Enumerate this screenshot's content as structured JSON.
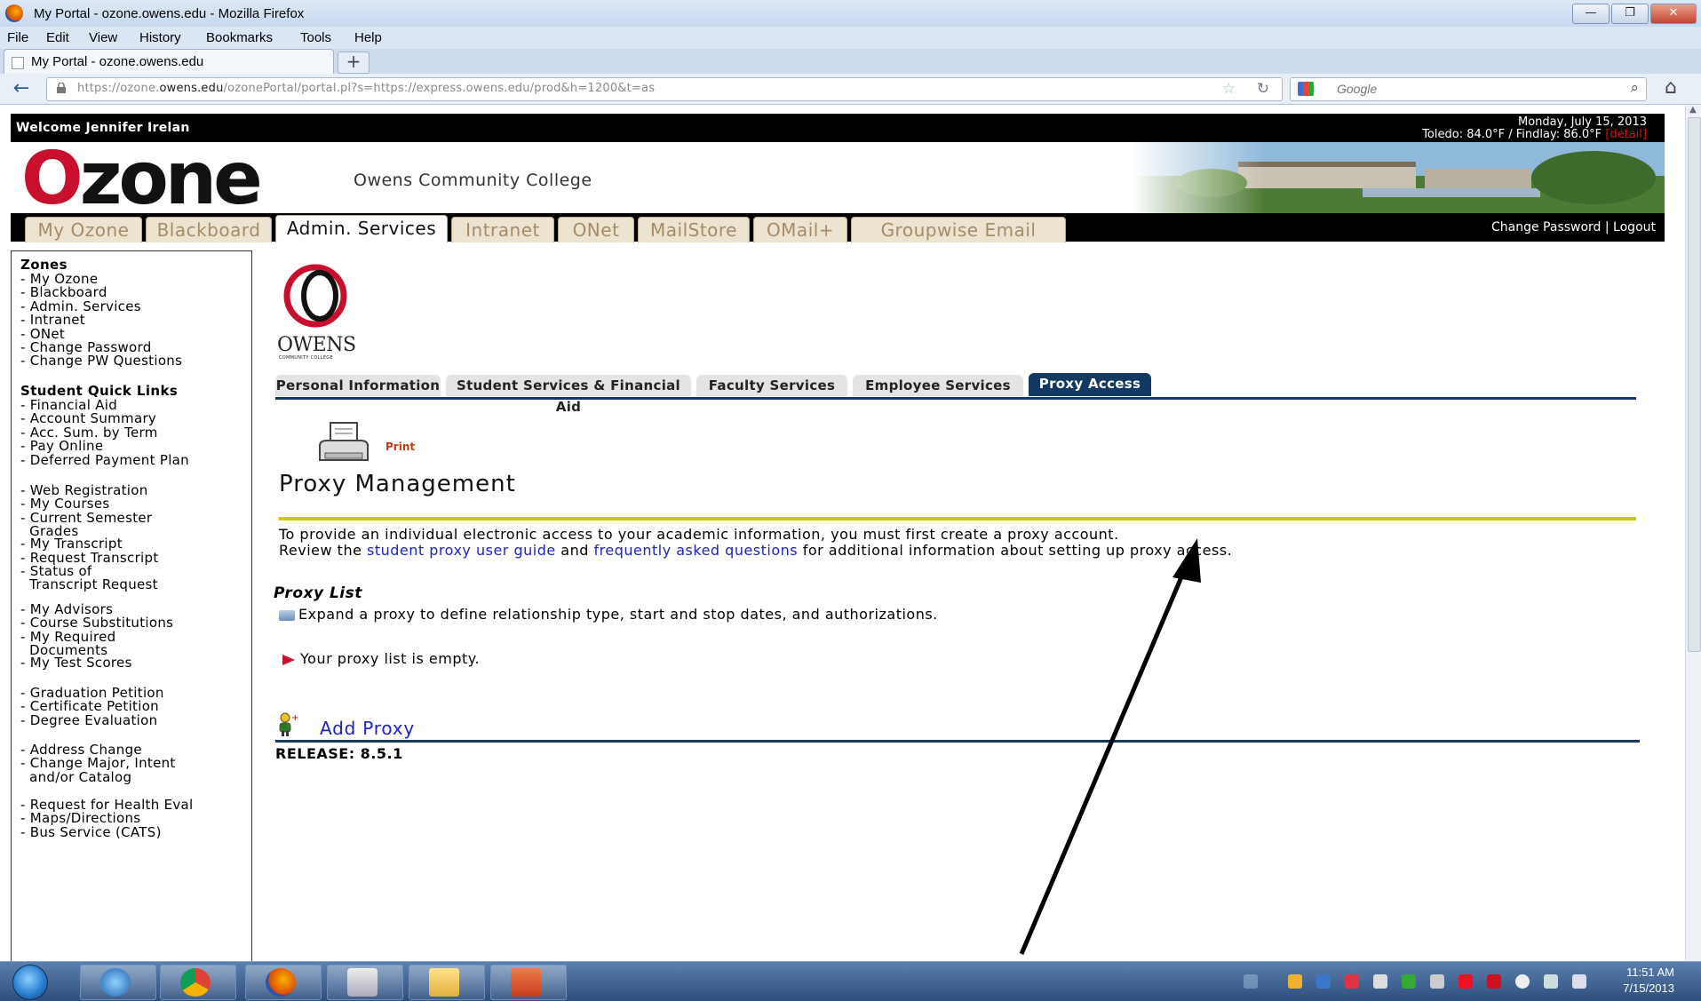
{
  "window": {
    "title": "My Portal - ozone.owens.edu - Mozilla Firefox",
    "controls": [
      "—",
      "❐",
      "✕"
    ]
  },
  "menubar": [
    "File",
    "Edit",
    "View",
    "History",
    "Bookmarks",
    "Tools",
    "Help"
  ],
  "browser_tab": {
    "label": "My Portal - ozone.owens.edu",
    "new_tab_label": "+"
  },
  "navbar": {
    "url_host": "https://ozone.",
    "url_domain": "owens.edu",
    "url_path": "/ozonePortal/portal.pl?s=https://express.owens.edu/prod&h=1200&t=as",
    "search_placeholder": "Google"
  },
  "portal": {
    "welcome": "Welcome Jennifer Irelan",
    "date": "Monday, July 15, 2013",
    "weather": "Toledo: 84.0°F / Findlay: 86.0°F",
    "weather_details": "[detail]",
    "logo_first": "O",
    "logo_rest": "zone",
    "college": "Owens Community College",
    "tabs": [
      {
        "label": "My Ozone",
        "active": false
      },
      {
        "label": "Blackboard",
        "active": false
      },
      {
        "label": "Admin. Services",
        "active": true
      },
      {
        "label": "Intranet",
        "active": false
      },
      {
        "label": "ONet",
        "active": false
      },
      {
        "label": "MailStore",
        "active": false
      },
      {
        "label": "OMail+",
        "active": false
      },
      {
        "label": "Groupwise Email",
        "active": false
      }
    ],
    "account_links": "Change Password | Logout"
  },
  "sidebar": {
    "zones_title": "Zones",
    "zones": [
      "- My Ozone",
      "- Blackboard",
      "- Admin. Services",
      "- Intranet",
      "- ONet",
      "- Change Password",
      "- Change PW Questions"
    ],
    "quick_title": "Student Quick Links",
    "group1": [
      "- Financial Aid",
      "- Account Summary",
      "- Acc. Sum. by Term",
      "- Pay Online",
      "- Deferred Payment Plan"
    ],
    "group2": [
      "- Web Registration",
      "- My Courses",
      "- Current Semester",
      "  Grades",
      "- My Transcript",
      "- Request Transcript",
      "- Status of",
      "  Transcript Request"
    ],
    "group3": [
      "- My Advisors",
      "- Course Substitutions",
      "- My Required",
      "  Documents",
      "- My Test Scores"
    ],
    "group4": [
      "- Graduation Petition",
      "- Certificate Petition",
      "- Degree Evaluation"
    ],
    "group5": [
      "- Address Change",
      "- Change Major, Intent",
      "  and/or Catalog"
    ],
    "group6": [
      "- Request for Health Eval",
      "- Maps/Directions",
      "- Bus Service (CATS)"
    ]
  },
  "owens_logo": {
    "word": "OWENS",
    "sub": "COMMUNITY COLLEGE"
  },
  "banner": {
    "tabs": [
      {
        "label": "Personal Information",
        "active": false
      },
      {
        "label": "Student Services & Financial Aid",
        "active": false
      },
      {
        "label": "Faculty Services",
        "active": false
      },
      {
        "label": "Employee Services",
        "active": false
      },
      {
        "label": "Proxy Access",
        "active": true
      }
    ],
    "print_label": "Print",
    "page_title": "Proxy Management",
    "intro_line1": "To provide an individual electronic access to your academic information, you must first create a proxy account.",
    "intro_line2_a": "Review the ",
    "intro_link1": "student proxy user guide",
    "intro_line2_b": " and ",
    "intro_link2": "frequently asked questions",
    "intro_line2_c": " for additional information about setting up proxy access.",
    "proxy_list_title": "Proxy List",
    "expand_text": "Expand a proxy to define relationship type, start and stop dates, and authorizations.",
    "empty_text": "Your proxy list is empty.",
    "add_proxy": "Add Proxy",
    "release": "RELEASE: 8.5.1"
  },
  "taskbar": {
    "apps": [
      "internet-explorer",
      "chrome",
      "firefox",
      "mail",
      "file-explorer",
      "powerpoint"
    ],
    "clock_time": "11:51 AM",
    "clock_date": "7/15/2013"
  }
}
